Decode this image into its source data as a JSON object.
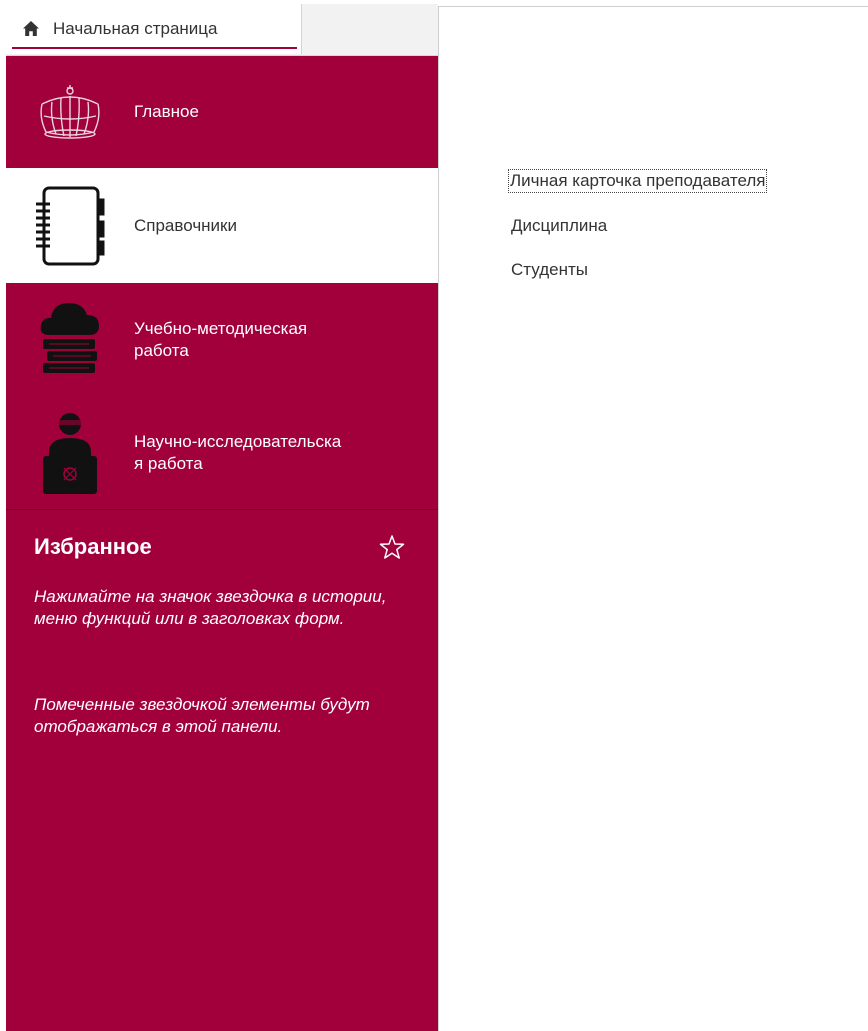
{
  "tabs": {
    "home": {
      "label": "Начальная страница",
      "icon": "home-icon"
    }
  },
  "sidebar": {
    "sections": [
      {
        "label": "Главное",
        "icon": "crown-icon",
        "active": false
      },
      {
        "label": "Справочники",
        "icon": "notebook-icon",
        "active": true
      },
      {
        "label": "Учебно-методическая\nработа",
        "icon": "cloud-books-icon",
        "active": false
      },
      {
        "label": "Научно-исследовательска\nя работа",
        "icon": "researcher-icon",
        "active": false
      }
    ],
    "favorites": {
      "title": "Избранное",
      "icon": "star-icon",
      "hint1": "Нажимайте на значок звездочка в истории, меню функций или в заголовках форм.",
      "hint2": "Помеченные звездочкой элементы будут отображаться в этой панели."
    }
  },
  "content": {
    "links": [
      {
        "label": "Личная карточка преподавателя",
        "focused": true
      },
      {
        "label": "Дисциплина",
        "focused": false
      },
      {
        "label": "Студенты",
        "focused": false
      }
    ]
  },
  "colors": {
    "brand": "#a1003a",
    "text": "#333333",
    "panel": "#ffffff"
  }
}
